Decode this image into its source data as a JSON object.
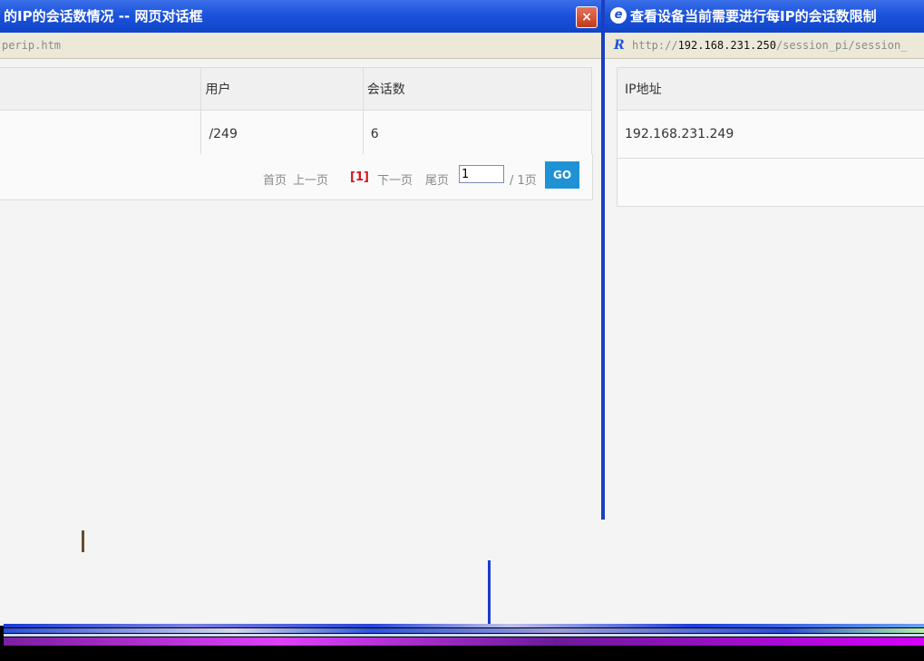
{
  "left_window": {
    "title": "的IP的会话数情况 -- 网页对话框",
    "close_label": "×",
    "url": "perip.htm",
    "table": {
      "headers": [
        "",
        "用户",
        "会话数"
      ],
      "rows": [
        [
          "",
          "/249",
          "6"
        ]
      ]
    },
    "pager": {
      "first": "首页",
      "prev": "上一页",
      "current": "[1]",
      "next": "下一页",
      "last": "尾页",
      "page_input_value": "1",
      "total": "/ 1页",
      "go": "GO"
    }
  },
  "right_window": {
    "title": "查看设备当前需要进行每IP的会话数限制",
    "ie_icon": "e",
    "logo_icon": "R",
    "url_prefix": "http://",
    "url_host": "192.168.231.250",
    "url_path": "/session_pi/session_",
    "table": {
      "headers": [
        "IP地址"
      ],
      "rows": [
        [
          "192.168.231.249"
        ],
        [
          ""
        ]
      ]
    }
  },
  "colors": {
    "titlebar": "#1c53dc",
    "go_button": "#1f92d6",
    "pager_current": "#d9121b"
  }
}
